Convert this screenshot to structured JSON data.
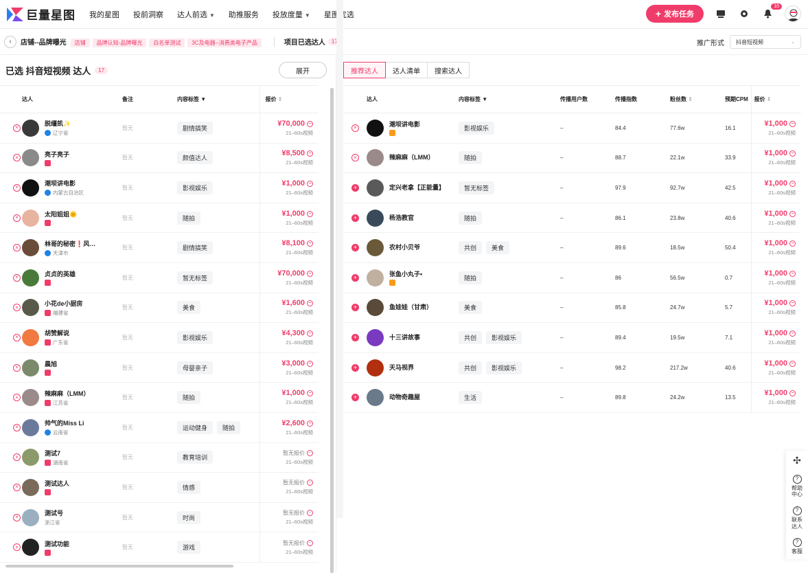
{
  "nav": {
    "logo": "巨量星图",
    "items": [
      {
        "label": "我的星图",
        "caret": false
      },
      {
        "label": "投前洞察",
        "caret": false
      },
      {
        "label": "达人前选",
        "caret": true
      },
      {
        "label": "助推服务",
        "caret": false
      },
      {
        "label": "投放度量",
        "caret": true
      },
      {
        "label": "星图优选",
        "caret": false
      }
    ],
    "publish": "发布任务",
    "badge": "10"
  },
  "subbar": {
    "shop": "店铺--品牌曝光",
    "tags": [
      "店铺",
      "品牌认知-品牌曝光",
      "白名单测试",
      "3C及电器--消费类电子产品"
    ],
    "project_label": "项目已选达人",
    "project_count": "17",
    "promo_label": "推广形式",
    "promo_value": "抖音短视频"
  },
  "left": {
    "title": "已选 抖音短视频 达人",
    "count": "17",
    "expand": "展开",
    "headers": [
      "达人",
      "备注",
      "内容标签",
      "报价"
    ],
    "rows": [
      {
        "name": "脱缰凯✨",
        "region": "辽宁省",
        "note": "暂无",
        "tags": [
          "剧情搞笑"
        ],
        "price": "¥70,000",
        "ptype": "21–60s视频",
        "plat": "b",
        "avc": "#3a3a3a"
      },
      {
        "name": "亮子亮子",
        "region": "",
        "note": "暂无",
        "tags": [
          "颜值达人"
        ],
        "price": "¥8,500",
        "ptype": "21–60s视频",
        "plat": "d",
        "avc": "#8a8a8a"
      },
      {
        "name": "潮坝讲电影",
        "region": "内蒙古自治区",
        "note": "暂无",
        "tags": [
          "影视娱乐"
        ],
        "price": "¥1,000",
        "ptype": "21–60s视频",
        "plat": "b",
        "avc": "#111"
      },
      {
        "name": "太阳姐姐🌞",
        "region": "",
        "note": "暂无",
        "tags": [
          "随拍"
        ],
        "price": "¥1,000",
        "ptype": "21–60s视频",
        "plat": "d",
        "avc": "#e8b4a0"
      },
      {
        "name": "林哥的秘密❗风…",
        "region": "天津市",
        "note": "暂无",
        "tags": [
          "剧情搞笑"
        ],
        "price": "¥8,100",
        "ptype": "21–60s视频",
        "plat": "b",
        "avc": "#6a4c3a"
      },
      {
        "name": "贞贞的英雄",
        "region": "",
        "note": "暂无",
        "tags": [
          "暂无标签"
        ],
        "price": "¥70,000",
        "ptype": "21–60s视频",
        "plat": "d",
        "avc": "#4a7a3a"
      },
      {
        "name": "小花de小厨房",
        "region": "福建省",
        "note": "暂无",
        "tags": [
          "美食"
        ],
        "price": "¥1,600",
        "ptype": "21–60s视频",
        "plat": "d",
        "avc": "#5a5a4a"
      },
      {
        "name": "胡赞解说",
        "region": "广东省",
        "note": "暂无",
        "tags": [
          "影视娱乐"
        ],
        "price": "¥4,300",
        "ptype": "21–60s视频",
        "plat": "d",
        "avc": "#f07a40"
      },
      {
        "name": "晨旭",
        "region": "",
        "note": "暂无",
        "tags": [
          "母婴亲子"
        ],
        "price": "¥3,000",
        "ptype": "21–60s视频",
        "plat": "d",
        "avc": "#7a8a6a"
      },
      {
        "name": "辣麻麻（LMM）",
        "region": "江苏省",
        "note": "暂无",
        "tags": [
          "随拍"
        ],
        "price": "¥1,000",
        "ptype": "21–60s视频",
        "plat": "d",
        "avc": "#9a8a8a"
      },
      {
        "name": "帅气的Miss Li",
        "region": "云南省",
        "note": "暂无",
        "tags": [
          "运动健身",
          "随拍"
        ],
        "price": "¥2,600",
        "ptype": "21–60s视频",
        "plat": "b",
        "avc": "#6a7a9a"
      },
      {
        "name": "测试7",
        "region": "湖南省",
        "note": "暂无",
        "tags": [
          "教育培训"
        ],
        "price": "暂无报价",
        "ptype": "21–60s视频",
        "plat": "d",
        "avc": "#8a9a6a"
      },
      {
        "name": "测试达人",
        "region": "",
        "note": "暂无",
        "tags": [
          "情感"
        ],
        "price": "暂无报价",
        "ptype": "21–60s视频",
        "plat": "d",
        "avc": "#7a6a5a"
      },
      {
        "name": "测试号",
        "region": "浙江省",
        "note": "暂无",
        "tags": [
          "时尚"
        ],
        "price": "暂无报价",
        "ptype": "21–60s视频",
        "plat": "n",
        "avc": "#9ab0c0"
      },
      {
        "name": "测试功能",
        "region": "",
        "note": "暂无",
        "tags": [
          "游戏"
        ],
        "price": "暂无报价",
        "ptype": "21–60s视频",
        "plat": "d",
        "avc": "#222"
      }
    ]
  },
  "right": {
    "tabs": [
      "推荐达人",
      "达人清单",
      "搜索达人"
    ],
    "headers": [
      "达人",
      "内容标签",
      "传播用户数",
      "传播指数",
      "粉丝数",
      "预期CPM",
      "报价"
    ],
    "rows": [
      {
        "name": "潮坝讲电影",
        "sel": true,
        "plat": "t",
        "tags": [
          "影视娱乐"
        ],
        "users": "–",
        "idx": "84.4",
        "fans": "77.6w",
        "cpm": "16.1",
        "price": "¥1,000",
        "ptype": "21–60s视频",
        "avc": "#111"
      },
      {
        "name": "辣麻麻（LMM）",
        "sel": true,
        "plat": "",
        "tags": [
          "随拍"
        ],
        "users": "–",
        "idx": "88.7",
        "fans": "22.1w",
        "cpm": "33.9",
        "price": "¥1,000",
        "ptype": "21–60s视频",
        "avc": "#9a8a8a"
      },
      {
        "name": "定兴老拿【正能量】",
        "sel": false,
        "plat": "",
        "tags": [
          "暂无标签"
        ],
        "users": "–",
        "idx": "97.9",
        "fans": "92.7w",
        "cpm": "42.5",
        "price": "¥1,000",
        "ptype": "21–60s视频",
        "avc": "#5a5a5a"
      },
      {
        "name": "杨浩教官",
        "sel": false,
        "plat": "",
        "tags": [
          "随拍"
        ],
        "users": "–",
        "idx": "86.1",
        "fans": "23.8w",
        "cpm": "40.6",
        "price": "¥1,000",
        "ptype": "21–60s视频",
        "avc": "#3a4a5a"
      },
      {
        "name": "农村小贝爷",
        "sel": false,
        "plat": "",
        "tags": [
          "共创",
          "美食"
        ],
        "users": "–",
        "idx": "89.6",
        "fans": "18.5w",
        "cpm": "50.4",
        "price": "¥1,000",
        "ptype": "21–60s视频",
        "avc": "#6a5a3a"
      },
      {
        "name": "张鱼小丸子•",
        "sel": false,
        "plat": "t",
        "tags": [
          "随拍"
        ],
        "users": "–",
        "idx": "86",
        "fans": "56.5w",
        "cpm": "0.7",
        "price": "¥1,000",
        "ptype": "21–60s视频",
        "avc": "#c0b0a0"
      },
      {
        "name": "鱼娃娃（甘肃）",
        "sel": false,
        "plat": "",
        "tags": [
          "美食"
        ],
        "users": "–",
        "idx": "85.8",
        "fans": "24.7w",
        "cpm": "5.7",
        "price": "¥1,000",
        "ptype": "21–60s视频",
        "avc": "#5a4a3a"
      },
      {
        "name": "十三讲故事",
        "sel": false,
        "plat": "",
        "tags": [
          "共创",
          "影视娱乐"
        ],
        "users": "–",
        "idx": "89.4",
        "fans": "19.5w",
        "cpm": "7.1",
        "price": "¥1,000",
        "ptype": "21–60s视频",
        "avc": "#7a3ac0"
      },
      {
        "name": "天马视界",
        "sel": false,
        "plat": "",
        "tags": [
          "共创",
          "影视娱乐"
        ],
        "users": "–",
        "idx": "98.2",
        "fans": "217.2w",
        "cpm": "40.6",
        "price": "¥1,000",
        "ptype": "21–60s视频",
        "avc": "#b03010"
      },
      {
        "name": "动物奇趣屋",
        "sel": false,
        "plat": "",
        "tags": [
          "生活"
        ],
        "users": "–",
        "idx": "89.8",
        "fans": "24.2w",
        "cpm": "13.5",
        "price": "¥1,000",
        "ptype": "21–60s视频",
        "avc": "#6a7a8a"
      }
    ]
  },
  "float": [
    {
      "label": "帮助中心",
      "icon": "help-icon"
    },
    {
      "label": "联系达人",
      "icon": "chat-icon"
    },
    {
      "label": "客服",
      "icon": "headset-icon"
    }
  ]
}
